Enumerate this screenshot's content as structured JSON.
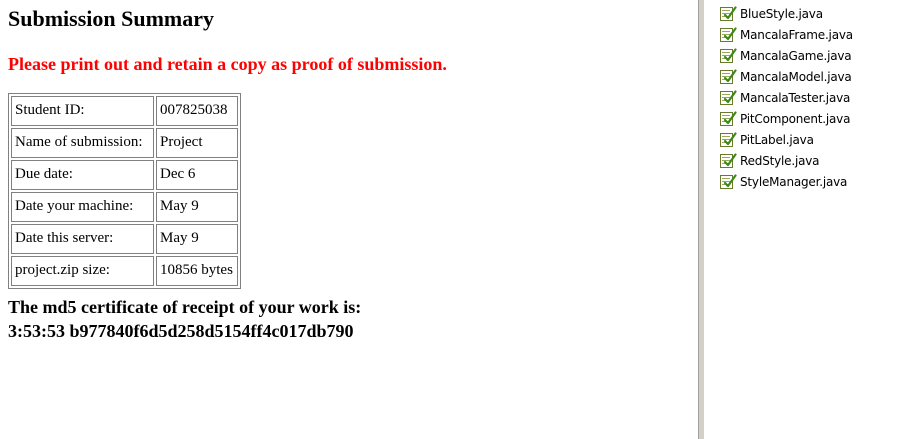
{
  "main": {
    "title": "Submission Summary",
    "notice": "Please print out and retain a copy as proof of submission.",
    "notice_color": "#ff0000",
    "rows": [
      {
        "label": "Student ID:",
        "value": "007825038"
      },
      {
        "label": "Name of submission:",
        "value": "Project"
      },
      {
        "label": "Due date:",
        "value": "Dec 6"
      },
      {
        "label": "Date your machine:",
        "value": "May 9"
      },
      {
        "label": "Date this server:",
        "value": "May 9"
      },
      {
        "label": "project.zip size:",
        "value": "10856 bytes"
      }
    ],
    "certificate_label": "The md5 certificate of receipt of your work is:",
    "certificate_value": "3:53:53 b977840f6d5d258d5154ff4c017db790"
  },
  "file_panel": {
    "icon": "java-file-icon",
    "files": [
      "BlueStyle.java",
      "MancalaFrame.java",
      "MancalaGame.java",
      "MancalaModel.java",
      "MancalaTester.java",
      "PitComponent.java",
      "PitLabel.java",
      "RedStyle.java",
      "StyleManager.java"
    ]
  }
}
